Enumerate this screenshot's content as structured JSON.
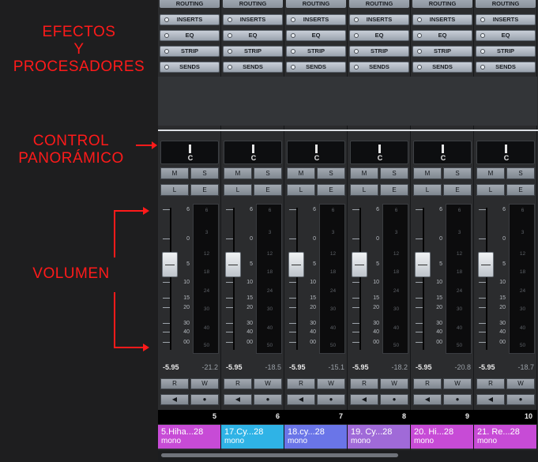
{
  "annotations": {
    "effects_line1": "EFECTOS",
    "effects_line2": "Y",
    "effects_line3": "PROCESADORES",
    "pan_line1": "CONTROL",
    "pan_line2": "PANORÁMICO",
    "volume": "VOLUMEN",
    "arrow_color": "#ff1a1a"
  },
  "sections": {
    "routing": "ROUTING",
    "inserts": "INSERTS",
    "eq": "EQ",
    "strip": "STRIP",
    "sends": "SENDS"
  },
  "buttons": {
    "m": "M",
    "s": "S",
    "l": "L",
    "e": "E",
    "r": "R",
    "w": "W",
    "play": "◀",
    "rec": "●"
  },
  "pan_label": "C",
  "fader_scale": [
    "6",
    "0",
    "5",
    "10",
    "15",
    "20",
    "30",
    "40",
    "00"
  ],
  "meter_scale": [
    "6",
    "3",
    "12",
    "18",
    "24",
    "30",
    "40",
    "50"
  ],
  "channels": [
    {
      "number": "5",
      "name": "5.Hiha...28",
      "type": "mono",
      "color": "#c74bd6",
      "volume": "-5.95",
      "peak": "-21.2"
    },
    {
      "number": "6",
      "name": "17.Cy...28",
      "type": "mono",
      "color": "#2fb3e6",
      "volume": "-5.95",
      "peak": "-18.5"
    },
    {
      "number": "7",
      "name": "18.cy...28",
      "type": "mono",
      "color": "#6a75e8",
      "volume": "-5.95",
      "peak": "-15.1"
    },
    {
      "number": "8",
      "name": "19. Cy...28",
      "type": "mono",
      "color": "#a06ad8",
      "volume": "-5.95",
      "peak": "-18.2"
    },
    {
      "number": "9",
      "name": "20. Hi...28",
      "type": "mono",
      "color": "#c74bd6",
      "volume": "-5.95",
      "peak": "-20.8"
    },
    {
      "number": "10",
      "name": "21. Re...28",
      "type": "mono",
      "color": "#c74bd6",
      "volume": "-5.95",
      "peak": "-18.7"
    }
  ]
}
